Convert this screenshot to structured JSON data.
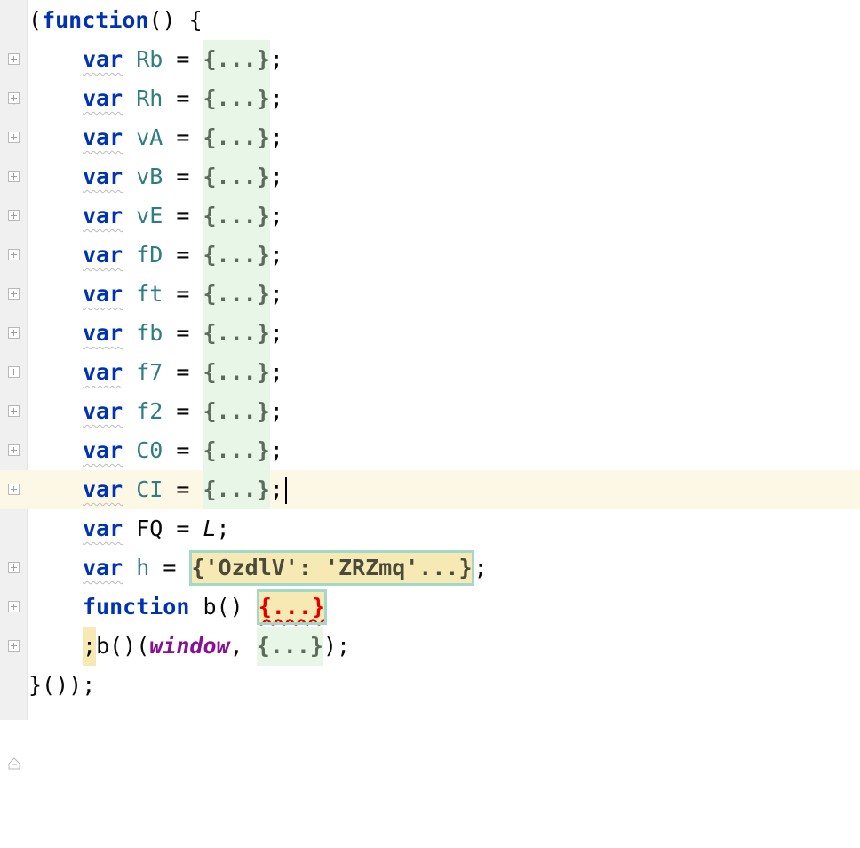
{
  "editor": {
    "header": {
      "open": "(",
      "keyword": "function",
      "rest": "() {"
    },
    "var_keyword": "var",
    "equals": " = ",
    "folded": "{...}",
    "semicolon": ";",
    "var_lines": [
      {
        "name": "Rb"
      },
      {
        "name": "Rh"
      },
      {
        "name": "vA"
      },
      {
        "name": "vB"
      },
      {
        "name": "vE"
      },
      {
        "name": "fD"
      },
      {
        "name": "ft"
      },
      {
        "name": "fb"
      },
      {
        "name": "f7"
      },
      {
        "name": "f2"
      },
      {
        "name": "C0"
      },
      {
        "name": "CI"
      }
    ],
    "fq_line": {
      "name": "FQ",
      "value": "L"
    },
    "h_line": {
      "name": "h",
      "value": "{'OzdlV': 'ZRZmq'...}"
    },
    "function_line": {
      "keyword": "function",
      "name": "b()",
      "body": "{...}"
    },
    "call_line": {
      "semi": ";",
      "call": "b()(",
      "arg1": "window",
      "sep": ", ",
      "arg2": "{...}",
      "close": ");"
    },
    "footer": "}());"
  }
}
